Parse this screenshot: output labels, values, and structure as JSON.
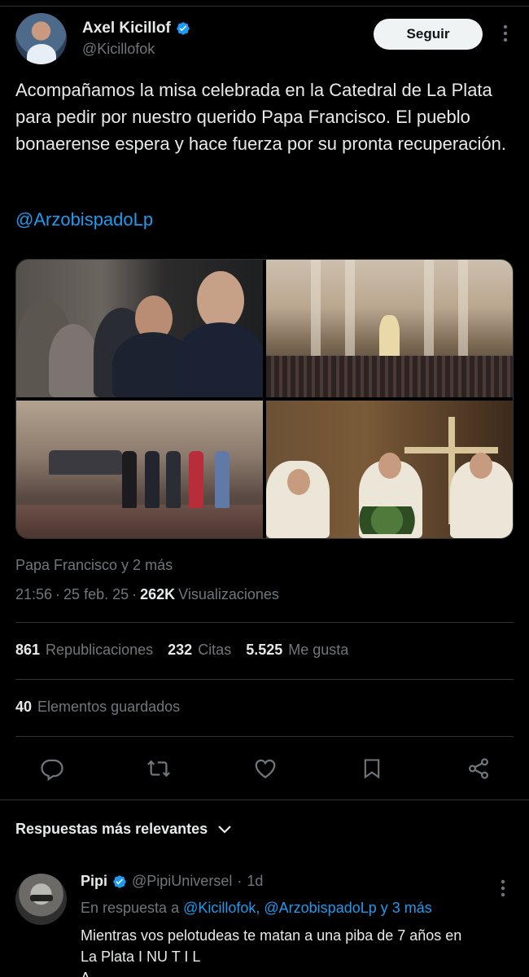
{
  "tweet": {
    "author": {
      "name": "Axel Kicillof",
      "handle": "@Kicillofok",
      "verified": true
    },
    "follow_label": "Seguir",
    "text": "Acompañamos la misa celebrada en la Catedral de La Plata para pedir por nuestro querido Papa Francisco. El pueblo bonaerense espera y hace fuerza por su pronta recuperación.",
    "mention": "@ArzobispadoLp",
    "tagged": "Papa Francisco y 2 más",
    "time": "21:56",
    "date": "25 feb. 25",
    "views_count": "262K",
    "views_label": "Visualizaciones",
    "stats": {
      "reposts": "861",
      "reposts_label": "Republicaciones",
      "quotes": "232",
      "quotes_label": "Citas",
      "likes": "5.525",
      "likes_label": "Me gusta",
      "bookmarks": "40",
      "bookmarks_label": "Elementos guardados"
    },
    "media_count": 4
  },
  "replies": {
    "header": "Respuestas más relevantes",
    "items": [
      {
        "name": "Pipi",
        "handle": "@PipiUniversel",
        "age": "1d",
        "in_reply_prefix": "En respuesta a",
        "in_reply_targets": "@Kicillofok, @ArzobispadoLp y 3 más",
        "text_line1": "Mientras vos pelotudeas te matan a una piba de 7 años en",
        "text_line2": "La Plata I NU T I L",
        "text_line3": "A"
      }
    ]
  },
  "colors": {
    "background": "#000000",
    "text": "#e7e9ea",
    "muted": "#71767b",
    "link": "#1d9bf0",
    "divider": "#2f3336"
  },
  "icons": [
    "verified-badge-icon",
    "more-icon",
    "reply-icon",
    "repost-icon",
    "like-icon",
    "bookmark-icon",
    "share-icon",
    "chevron-down-icon"
  ]
}
